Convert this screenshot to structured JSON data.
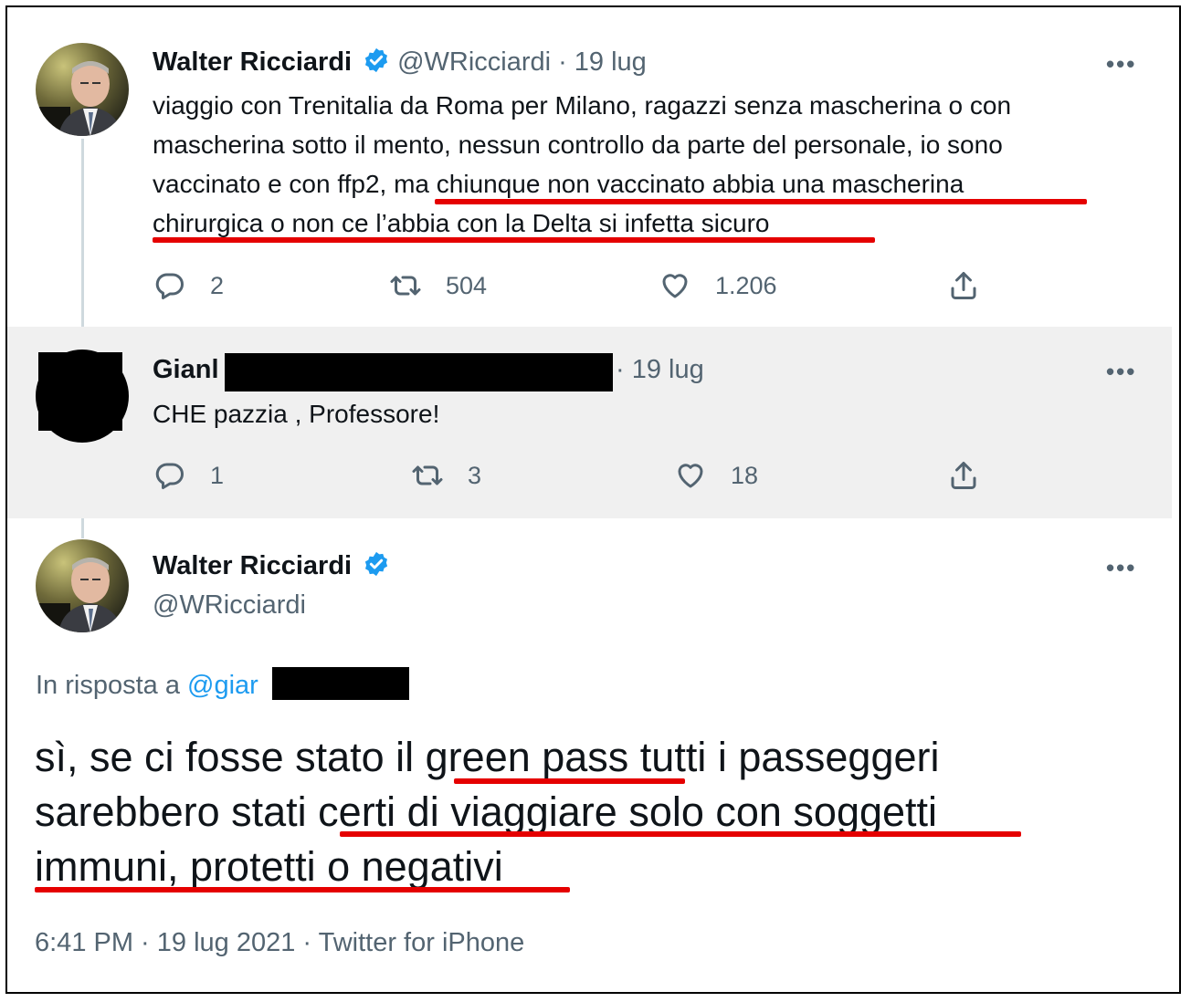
{
  "tweet1": {
    "name": "Walter Ricciardi",
    "handle": "@WRicciardi",
    "sep": "·",
    "date": "19 lug",
    "lines": [
      "viaggio con Trenitalia da Roma per Milano, ragazzi senza mascherina o con",
      "mascherina sotto il mento, nessun controllo da parte del personale, io sono",
      "vaccinato e con ffp2, ma chiunque non vaccinato abbia una mascherina",
      "chirurgica o non ce l’abbia con la Delta si infetta sicuro"
    ],
    "stats": {
      "replies": "2",
      "retweets": "504",
      "likes": "1.206"
    }
  },
  "tweet2": {
    "name_visible": "Gianl",
    "date": "· 19 lug",
    "text": "CHE pazzia , Professore!",
    "stats": {
      "replies": "1",
      "retweets": "3",
      "likes": "18"
    }
  },
  "tweet3": {
    "name": "Walter Ricciardi",
    "handle": "@WRicciardi",
    "reply_prefix": "In risposta a",
    "reply_handle": "@giar",
    "lines": [
      "sì, se ci fosse stato il green pass tutti i passeggeri",
      "sarebbero stati certi di viaggiare solo con soggetti",
      "immuni, protetti o negativi"
    ],
    "footer": "6:41 PM · 19 lug 2021 · Twitter for iPhone"
  },
  "ui": {
    "more_label": "•••"
  },
  "icons": {
    "verified": "verified-badge-icon",
    "reply": "reply-icon",
    "retweet": "retweet-icon",
    "like": "heart-icon",
    "share": "share-icon",
    "more": "more-icon"
  },
  "colors": {
    "accent": "#1d9bf0",
    "highlight": "#e50000",
    "muted": "#536471"
  }
}
